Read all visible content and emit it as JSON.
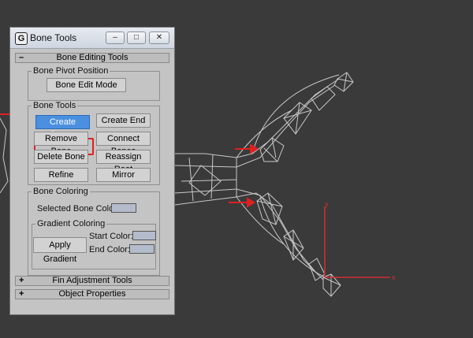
{
  "window": {
    "title": "Bone Tools",
    "minimize_glyph": "–",
    "maximize_glyph": "□",
    "close_glyph": "✕"
  },
  "rollouts": {
    "editing": {
      "sign": "–",
      "label": "Bone Editing Tools"
    },
    "fin": {
      "sign": "+",
      "label": "Fin Adjustment Tools"
    },
    "object": {
      "sign": "+",
      "label": "Object Properties"
    }
  },
  "pivot_group": {
    "label": "Bone Pivot Position",
    "edit_mode": "Bone Edit Mode"
  },
  "bone_tools_group": {
    "label": "Bone Tools",
    "create_bones": "Create Bones",
    "create_end": "Create End",
    "remove_bone": "Remove Bone",
    "connect_bones": "Connect Bones",
    "delete_bone": "Delete Bone",
    "reassign_root": "Reassign Root",
    "refine": "Refine",
    "mirror": "Mirror"
  },
  "coloring_group": {
    "label": "Bone Coloring",
    "selected_color_label": "Selected Bone Color:",
    "gradient_label": "Gradient Coloring",
    "apply_gradient": "Apply Gradient",
    "start_color_label": "Start Color:",
    "end_color_label": "End Color:"
  },
  "viewport": {
    "axis_x": "x",
    "axis_y": "y"
  },
  "colors": {
    "accent": "#4a8fe0",
    "highlight": "#e02020",
    "viewport_bg": "#3a3a3a"
  }
}
